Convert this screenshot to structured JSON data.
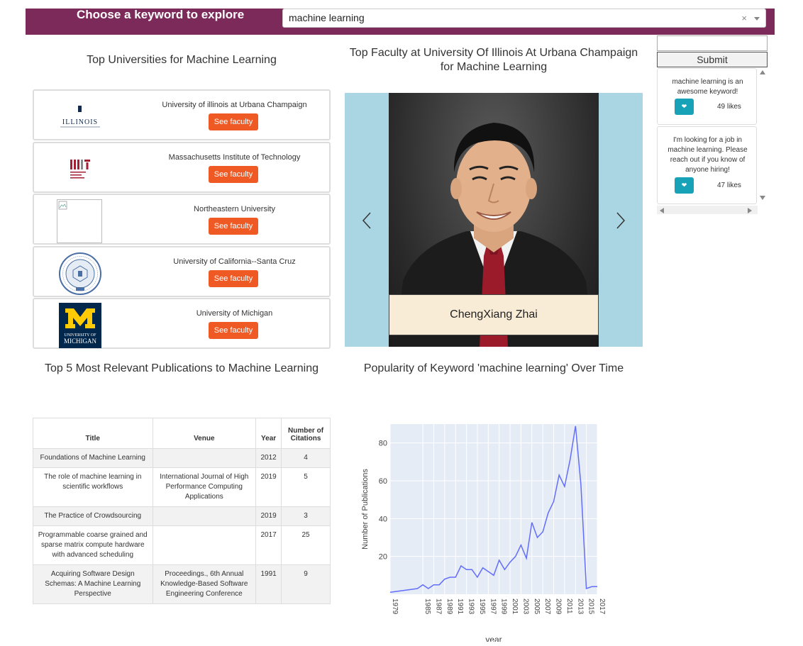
{
  "header": {
    "title": "Choose a keyword to explore",
    "keyword": "machine learning",
    "clear_glyph": "×"
  },
  "universities": {
    "title": "Top Universities for Machine Learning",
    "items": [
      {
        "name": "University of illinois at Urbana Champaign",
        "logo": "illinois-logo",
        "logo_text": "ILLINOIS",
        "button": "See faculty"
      },
      {
        "name": "Massachusetts Institute of Technology",
        "logo": "mit-logo",
        "logo_text": "MIT",
        "button": "See faculty"
      },
      {
        "name": "Northeastern University",
        "logo": "broken-image",
        "logo_text": "",
        "button": "See faculty"
      },
      {
        "name": "University of California--Santa Cruz",
        "logo": "uc-seal-logo",
        "logo_text": "THE UNIVERSITY OF CALIFORNIA 1868",
        "button": "See faculty"
      },
      {
        "name": "University of Michigan",
        "logo": "michigan-logo",
        "logo_text": "M UNIVERSITY OF MICHIGAN",
        "button": "See faculty"
      }
    ]
  },
  "faculty": {
    "title": "Top Faculty at University Of Illinois At Urbana Champaign for Machine Learning",
    "current_name": "ChengXiang Zhai"
  },
  "comments": {
    "submit_label": "Submit",
    "items": [
      {
        "text": "machine learning is an awesome keyword!",
        "likes": "49 likes"
      },
      {
        "text": "I'm looking for a job in machine learning. Please reach out if you know of anyone hiring!",
        "likes": "47 likes"
      }
    ]
  },
  "publications": {
    "title": "Top 5 Most Relevant Publications to Machine Learning",
    "columns": [
      "Title",
      "Venue",
      "Year",
      "Number of Citations"
    ],
    "rows": [
      {
        "title": "Foundations of Machine Learning",
        "venue": "",
        "year": "2012",
        "citations": "4"
      },
      {
        "title": "The role of machine learning in scientific workflows",
        "venue": "International Journal of High Performance Computing Applications",
        "year": "2019",
        "citations": "5"
      },
      {
        "title": "The Practice of Crowdsourcing",
        "venue": "",
        "year": "2019",
        "citations": "3"
      },
      {
        "title": "Programmable coarse grained and sparse matrix compute hardware with advanced scheduling",
        "venue": "",
        "year": "2017",
        "citations": "25"
      },
      {
        "title": "Acquiring Software Design Schemas: A Machine Learning Perspective",
        "venue": "Proceedings., 6th Annual Knowledge-Based Software Engineering Conference",
        "year": "1991",
        "citations": "9"
      }
    ]
  },
  "popularity": {
    "title": "Popularity of Keyword 'machine learning' Over Time"
  },
  "chart_data": {
    "type": "line",
    "title": "",
    "xlabel": "year",
    "ylabel": "Number of Publications",
    "xlim": [
      1979,
      2017
    ],
    "ylim": [
      0,
      90
    ],
    "yticks": [
      20,
      40,
      60,
      80
    ],
    "xticks": [
      1979,
      1985,
      1987,
      1989,
      1991,
      1993,
      1995,
      1997,
      1999,
      2001,
      2003,
      2005,
      2007,
      2009,
      2011,
      2013,
      2015,
      2017
    ],
    "color": "#636efa",
    "background": "#e5ecf6",
    "grid": true,
    "x": [
      1979,
      1984,
      1985,
      1986,
      1987,
      1988,
      1989,
      1990,
      1991,
      1992,
      1993,
      1994,
      1995,
      1996,
      1997,
      1998,
      1999,
      2000,
      2001,
      2002,
      2003,
      2004,
      2005,
      2006,
      2007,
      2008,
      2009,
      2010,
      2011,
      2012,
      2013,
      2014,
      2015,
      2016,
      2017
    ],
    "y": [
      1,
      3,
      5,
      3,
      5,
      5,
      8,
      9,
      9,
      15,
      13,
      13,
      9,
      14,
      12,
      10,
      18,
      13,
      17,
      20,
      26,
      19,
      38,
      30,
      33,
      43,
      49,
      63,
      57,
      71,
      89,
      58,
      3,
      4,
      4
    ]
  }
}
